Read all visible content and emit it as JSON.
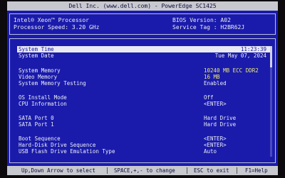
{
  "header": {
    "title": "Dell Inc. (www.dell.com) - PowerEdge SC1425"
  },
  "info": {
    "processor": "Intel® Xeon™ Processor",
    "processor_speed_label": "Processor Speed: 3.20 GHz",
    "bios_version": "BIOS Version: A02",
    "service_tag": "Service Tag : H2BR62J"
  },
  "settings": [
    {
      "label": "System Time",
      "value": "11:23:39"
    },
    {
      "label": "System Date",
      "value": "Tue May 07, 2024"
    },
    {
      "label": "System Memory",
      "value": "10240 MB ECC DDR2"
    },
    {
      "label": "Video Memory",
      "value": "16 MB"
    },
    {
      "label": "System Memory Testing",
      "value": "Enabled"
    },
    {
      "label": "OS Install Mode",
      "value": "Off"
    },
    {
      "label": "CPU Information",
      "value": "<ENTER>"
    },
    {
      "label": "SATA Port 0",
      "value": "Hard Drive"
    },
    {
      "label": "SATA Port 1",
      "value": "Hard Drive"
    },
    {
      "label": "Boot Sequence",
      "value": "<ENTER>"
    },
    {
      "label": "Hard-Disk Drive Sequence",
      "value": "<ENTER>"
    },
    {
      "label": "USB Flash Drive Emulation Type",
      "value": "Auto"
    }
  ],
  "footer": {
    "nav": "Up,Down Arrow to select",
    "change": "SPACE,+,- to change",
    "exit": "ESC to exit",
    "help": "F1=Help"
  },
  "colors": {
    "background": "#1a1bab",
    "bar": "#c8c9cf",
    "highlight_value": "#e9e77a"
  }
}
